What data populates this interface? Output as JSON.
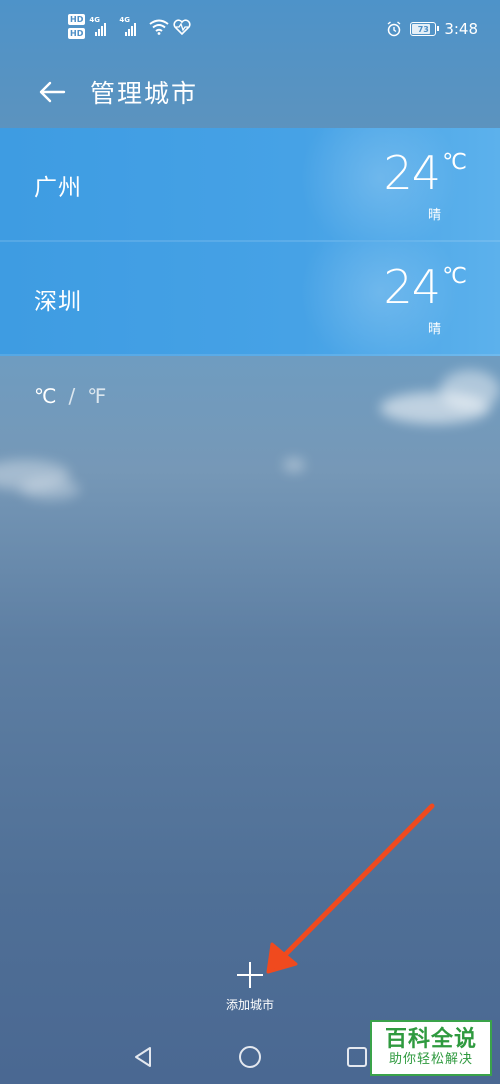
{
  "status_bar": {
    "hd1": "HD",
    "hd2": "HD",
    "net1": "4G",
    "net2": "4G",
    "battery_level": "73",
    "time": "3:48",
    "icons": [
      "signal-icon",
      "wifi-icon",
      "heart-rate-icon",
      "alarm-icon",
      "battery-icon"
    ]
  },
  "header": {
    "title": "管理城市",
    "back_icon": "back-arrow-icon"
  },
  "cities": [
    {
      "name": "广州",
      "temperature": "24",
      "unit": "℃",
      "condition": "晴"
    },
    {
      "name": "深圳",
      "temperature": "24",
      "unit": "℃",
      "condition": "晴"
    }
  ],
  "unit_toggle": {
    "celsius": "℃",
    "separator": "/",
    "fahrenheit": "℉"
  },
  "add_city": {
    "label": "添加城市",
    "icon": "plus-icon"
  },
  "annotation": {
    "arrow_color": "#f04a1e"
  },
  "watermark": {
    "title": "百科全说",
    "subtitle": "助你轻松解决"
  },
  "colors": {
    "row_blue": "#46a2e6",
    "watermark_green": "#2f9a3f"
  }
}
